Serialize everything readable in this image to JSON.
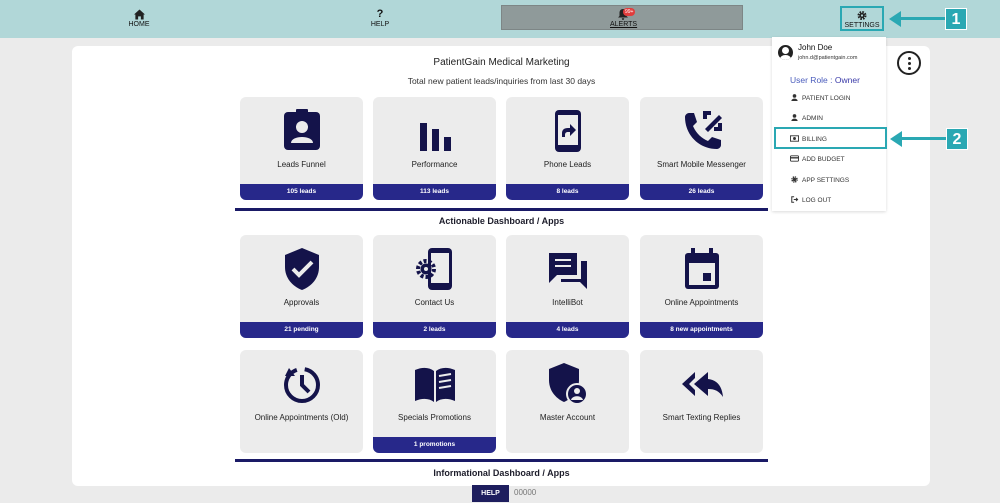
{
  "nav": {
    "home": "HOME",
    "help": "HELP",
    "alerts": "ALERTS",
    "alerts_badge": "99+",
    "settings": "SETTINGS"
  },
  "callouts": [
    "1",
    "2"
  ],
  "panel": {
    "title": "PatientGain Medical Marketing",
    "subtitle": "Total new patient leads/inquiries from last 30 days"
  },
  "sections": {
    "actionable": "Actionable Dashboard / Apps",
    "informational": "Informational Dashboard / Apps"
  },
  "cards_row1": [
    {
      "label": "Leads Funnel",
      "bar": "105 leads",
      "icon": "contact-badge-icon"
    },
    {
      "label": "Performance",
      "bar": "113 leads",
      "icon": "bar-chart-icon"
    },
    {
      "label": "Phone Leads",
      "bar": "8 leads",
      "icon": "phone-forward-icon"
    },
    {
      "label": "Smart Mobile Messenger",
      "bar": "26 leads",
      "icon": "phone-callback-icon"
    }
  ],
  "cards_row2": [
    {
      "label": "Approvals",
      "bar": "21 pending",
      "icon": "shield-check-icon"
    },
    {
      "label": "Contact Us",
      "bar": "2 leads",
      "icon": "phone-settings-icon"
    },
    {
      "label": "IntelliBot",
      "bar": "4 leads",
      "icon": "chat-bubbles-icon"
    },
    {
      "label": "Online Appointments",
      "bar": "8 new appointments",
      "icon": "calendar-icon"
    }
  ],
  "cards_row3": [
    {
      "label": "Online Appointments (Old)",
      "bar": "",
      "icon": "clock-refresh-icon"
    },
    {
      "label": "Specials Promotions",
      "bar": "1 promotions",
      "icon": "open-book-icon"
    },
    {
      "label": "Master Account",
      "bar": "",
      "icon": "shield-user-icon"
    },
    {
      "label": "Smart Texting Replies",
      "bar": "",
      "icon": "reply-all-icon"
    }
  ],
  "dropdown": {
    "name": "John Doe",
    "email": "john.d@patientgain.com",
    "role_label": "User Role",
    "role_sep": ":",
    "role_value": "Owner",
    "items": [
      "PATIENT LOGIN",
      "ADMIN",
      "BILLING",
      "ADD BUDGET",
      "APP SETTINGS",
      "LOG OUT"
    ]
  },
  "footer": {
    "help": "HELP",
    "code": "00000"
  },
  "colors": {
    "topbar": "#b1d7d8",
    "accent": "#2aa8b3",
    "navy": "#27288a",
    "icon": "#14134a"
  }
}
